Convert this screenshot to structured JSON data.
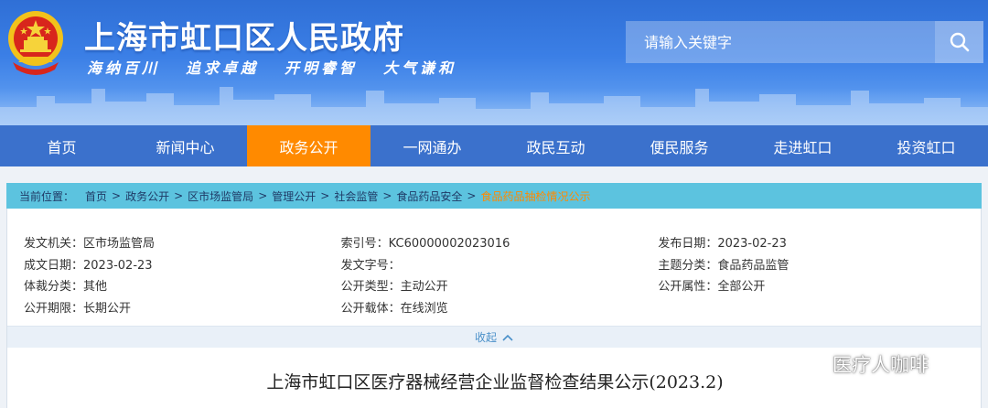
{
  "header": {
    "site_title": "上海市虹口区人民政府",
    "slogans": [
      "海纳百川",
      "追求卓越",
      "开明睿智",
      "大气谦和"
    ],
    "search_placeholder": "请输入关键字"
  },
  "nav": {
    "items": [
      "首页",
      "新闻中心",
      "政务公开",
      "一网通办",
      "政民互动",
      "便民服务",
      "走进虹口",
      "投资虹口"
    ],
    "active_index": 2
  },
  "breadcrumb": {
    "label": "当前位置：",
    "items": [
      "首页",
      "政务公开",
      "区市场监管局",
      "管理公开",
      "社会监管",
      "食品药品安全"
    ],
    "current": "食品药品抽检情况公示",
    "separator": ">"
  },
  "info": {
    "rows": [
      [
        "发文机关：区市场监管局",
        "索引号：KC60000002023016",
        "发布日期：2023-02-23"
      ],
      [
        "成文日期：2023-02-23",
        "发文字号：",
        "主题分类：食品药品监管"
      ],
      [
        "体裁分类：其他",
        "公开类型：主动公开",
        "公开属性：全部公开"
      ],
      [
        "公开期限：长期公开",
        "公开载体：在线浏览",
        ""
      ]
    ],
    "collapse_label": "收起"
  },
  "article": {
    "title": "上海市虹口区医疗器械经营企业监督检查结果公示(2023.2)"
  },
  "watermark": {
    "text": "医疗人咖啡"
  },
  "colors": {
    "nav_bg": "#3b71cc",
    "nav_active": "#ff8a00",
    "breadcrumb_bg": "#5cc3df",
    "breadcrumb_current": "#ff8a00"
  }
}
